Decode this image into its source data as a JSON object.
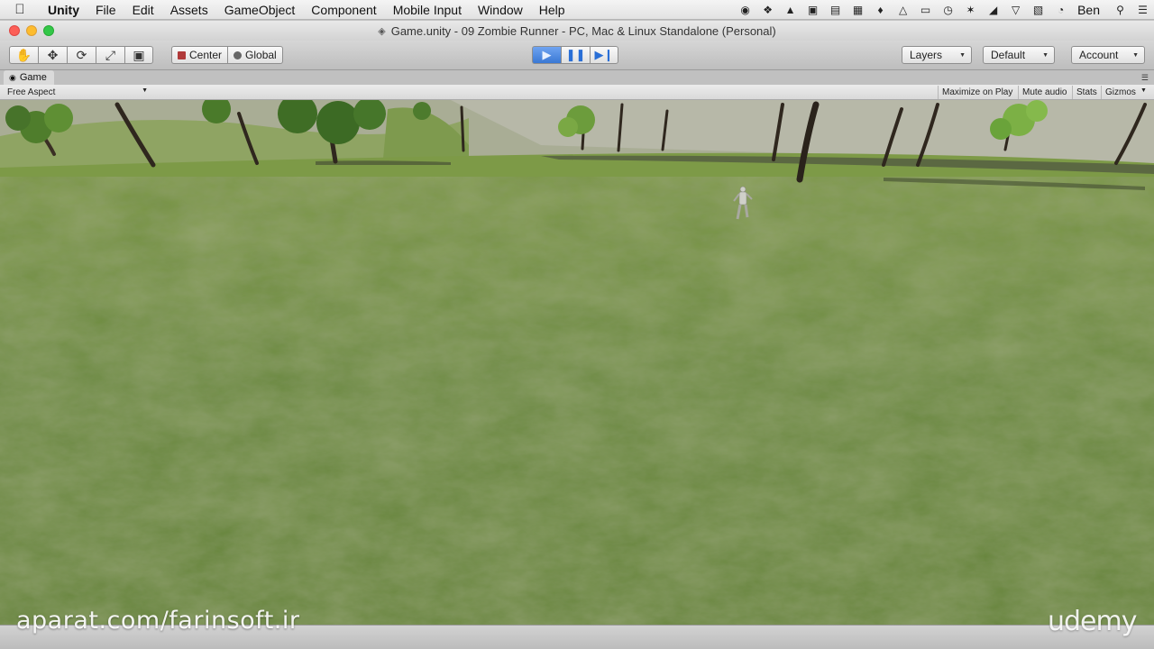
{
  "menubar": {
    "app_name": "Unity",
    "items": [
      "File",
      "Edit",
      "Assets",
      "GameObject",
      "Component",
      "Mobile Input",
      "Window",
      "Help"
    ],
    "user": "Ben"
  },
  "window": {
    "title": "Game.unity - 09 Zombie Runner - PC, Mac & Linux Standalone (Personal)"
  },
  "toolbar": {
    "pivot_label": "Center",
    "space_label": "Global",
    "layers_label": "Layers",
    "layout_label": "Default",
    "account_label": "Account"
  },
  "game_view": {
    "tab_label": "Game",
    "aspect_label": "Free Aspect",
    "maximize_label": "Maximize on Play",
    "mute_label": "Mute audio",
    "stats_label": "Stats",
    "gizmos_label": "Gizmos"
  },
  "overlay": {
    "watermark": "aparat.com/farinsoft.ir",
    "brand": "udemy"
  },
  "colors": {
    "play_active": "#3a78d4",
    "grass": "#6b8a3c"
  }
}
